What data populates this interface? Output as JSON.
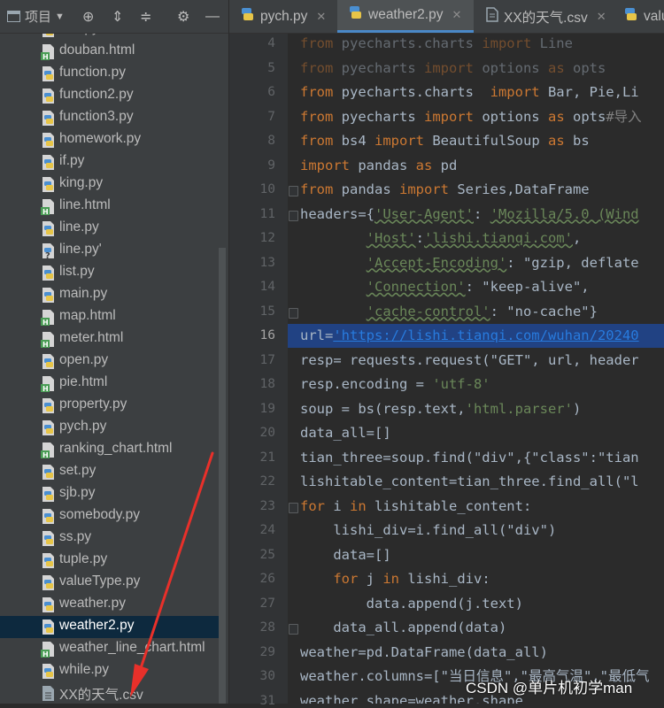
{
  "project_panel": {
    "title": "项目",
    "files": [
      {
        "name": "dict.py",
        "type": "py"
      },
      {
        "name": "douban.html",
        "type": "html"
      },
      {
        "name": "function.py",
        "type": "py"
      },
      {
        "name": "function2.py",
        "type": "py"
      },
      {
        "name": "function3.py",
        "type": "py"
      },
      {
        "name": "homework.py",
        "type": "py"
      },
      {
        "name": "if.py",
        "type": "py"
      },
      {
        "name": "king.py",
        "type": "py"
      },
      {
        "name": "line.html",
        "type": "html"
      },
      {
        "name": "line.py",
        "type": "py"
      },
      {
        "name": "line.py'",
        "type": "unknown"
      },
      {
        "name": "list.py",
        "type": "py"
      },
      {
        "name": "main.py",
        "type": "py"
      },
      {
        "name": "map.html",
        "type": "html"
      },
      {
        "name": "meter.html",
        "type": "html"
      },
      {
        "name": "open.py",
        "type": "py"
      },
      {
        "name": "pie.html",
        "type": "html"
      },
      {
        "name": "property.py",
        "type": "py"
      },
      {
        "name": "pych.py",
        "type": "py"
      },
      {
        "name": "ranking_chart.html",
        "type": "html"
      },
      {
        "name": "set.py",
        "type": "py"
      },
      {
        "name": "sjb.py",
        "type": "py"
      },
      {
        "name": "somebody.py",
        "type": "py"
      },
      {
        "name": "ss.py",
        "type": "py"
      },
      {
        "name": "tuple.py",
        "type": "py"
      },
      {
        "name": "valueType.py",
        "type": "py"
      },
      {
        "name": "weather.py",
        "type": "py"
      },
      {
        "name": "weather2.py",
        "type": "py",
        "selected": true
      },
      {
        "name": "weather_line_chart.html",
        "type": "html"
      },
      {
        "name": "while.py",
        "type": "py"
      },
      {
        "name": "XX的天气.csv",
        "type": "csv"
      }
    ]
  },
  "tabs": [
    {
      "label": "pych.py",
      "active": false
    },
    {
      "label": "weather2.py",
      "active": true
    },
    {
      "label": "XX的天气.csv",
      "active": false
    },
    {
      "label": "valu",
      "active": false
    }
  ],
  "editor": {
    "current_line": "16",
    "lines": [
      {
        "n": "4",
        "text": "from pyecharts.charts import Line"
      },
      {
        "n": "5",
        "text": "from pyecharts import options as opts"
      },
      {
        "n": "6",
        "text": "from pyecharts.charts  import Bar, Pie,Li"
      },
      {
        "n": "7",
        "text": "from pyecharts import options as opts#导入"
      },
      {
        "n": "8",
        "text": "from bs4 import BeautifulSoup as bs"
      },
      {
        "n": "9",
        "text": "import pandas as pd"
      },
      {
        "n": "10",
        "text": "from pandas import Series,DataFrame"
      },
      {
        "n": "11",
        "text": "headers={'User-Agent': 'Mozilla/5.0 (Wind"
      },
      {
        "n": "12",
        "text": "        'Host':'lishi.tianqi.com',"
      },
      {
        "n": "13",
        "text": "        'Accept-Encoding': \"gzip, deflate"
      },
      {
        "n": "14",
        "text": "        'Connection': \"keep-alive\","
      },
      {
        "n": "15",
        "text": "        'cache-control': \"no-cache\"}"
      },
      {
        "n": "16",
        "text": "url='https://lishi.tianqi.com/wuhan/20240"
      },
      {
        "n": "17",
        "text": "resp= requests.request(\"GET\", url, header"
      },
      {
        "n": "18",
        "text": "resp.encoding = 'utf-8'"
      },
      {
        "n": "19",
        "text": "soup = bs(resp.text,'html.parser')"
      },
      {
        "n": "20",
        "text": "data_all=[]"
      },
      {
        "n": "21",
        "text": "tian_three=soup.find(\"div\",{\"class\":\"tian"
      },
      {
        "n": "22",
        "text": "lishitable_content=tian_three.find_all(\"l"
      },
      {
        "n": "23",
        "text": "for i in lishitable_content:"
      },
      {
        "n": "24",
        "text": "    lishi_div=i.find_all(\"div\")"
      },
      {
        "n": "25",
        "text": "    data=[]"
      },
      {
        "n": "26",
        "text": "    for j in lishi_div:"
      },
      {
        "n": "27",
        "text": "        data.append(j.text)"
      },
      {
        "n": "28",
        "text": "    data_all.append(data)"
      },
      {
        "n": "29",
        "text": "weather=pd.DataFrame(data_all)"
      },
      {
        "n": "30",
        "text": "weather.columns=[\"当日信息\",\"最高气温\",\"最低气"
      },
      {
        "n": "31",
        "text": "weather_shape=weather.shape"
      }
    ]
  },
  "watermark": "CSDN @单片机初学man",
  "colors": {
    "panel_bg": "#3c3f41",
    "editor_bg": "#2b2b2b",
    "selection": "#214283",
    "tree_selection": "#0d293e",
    "annotation_arrow": "#e8302a"
  }
}
